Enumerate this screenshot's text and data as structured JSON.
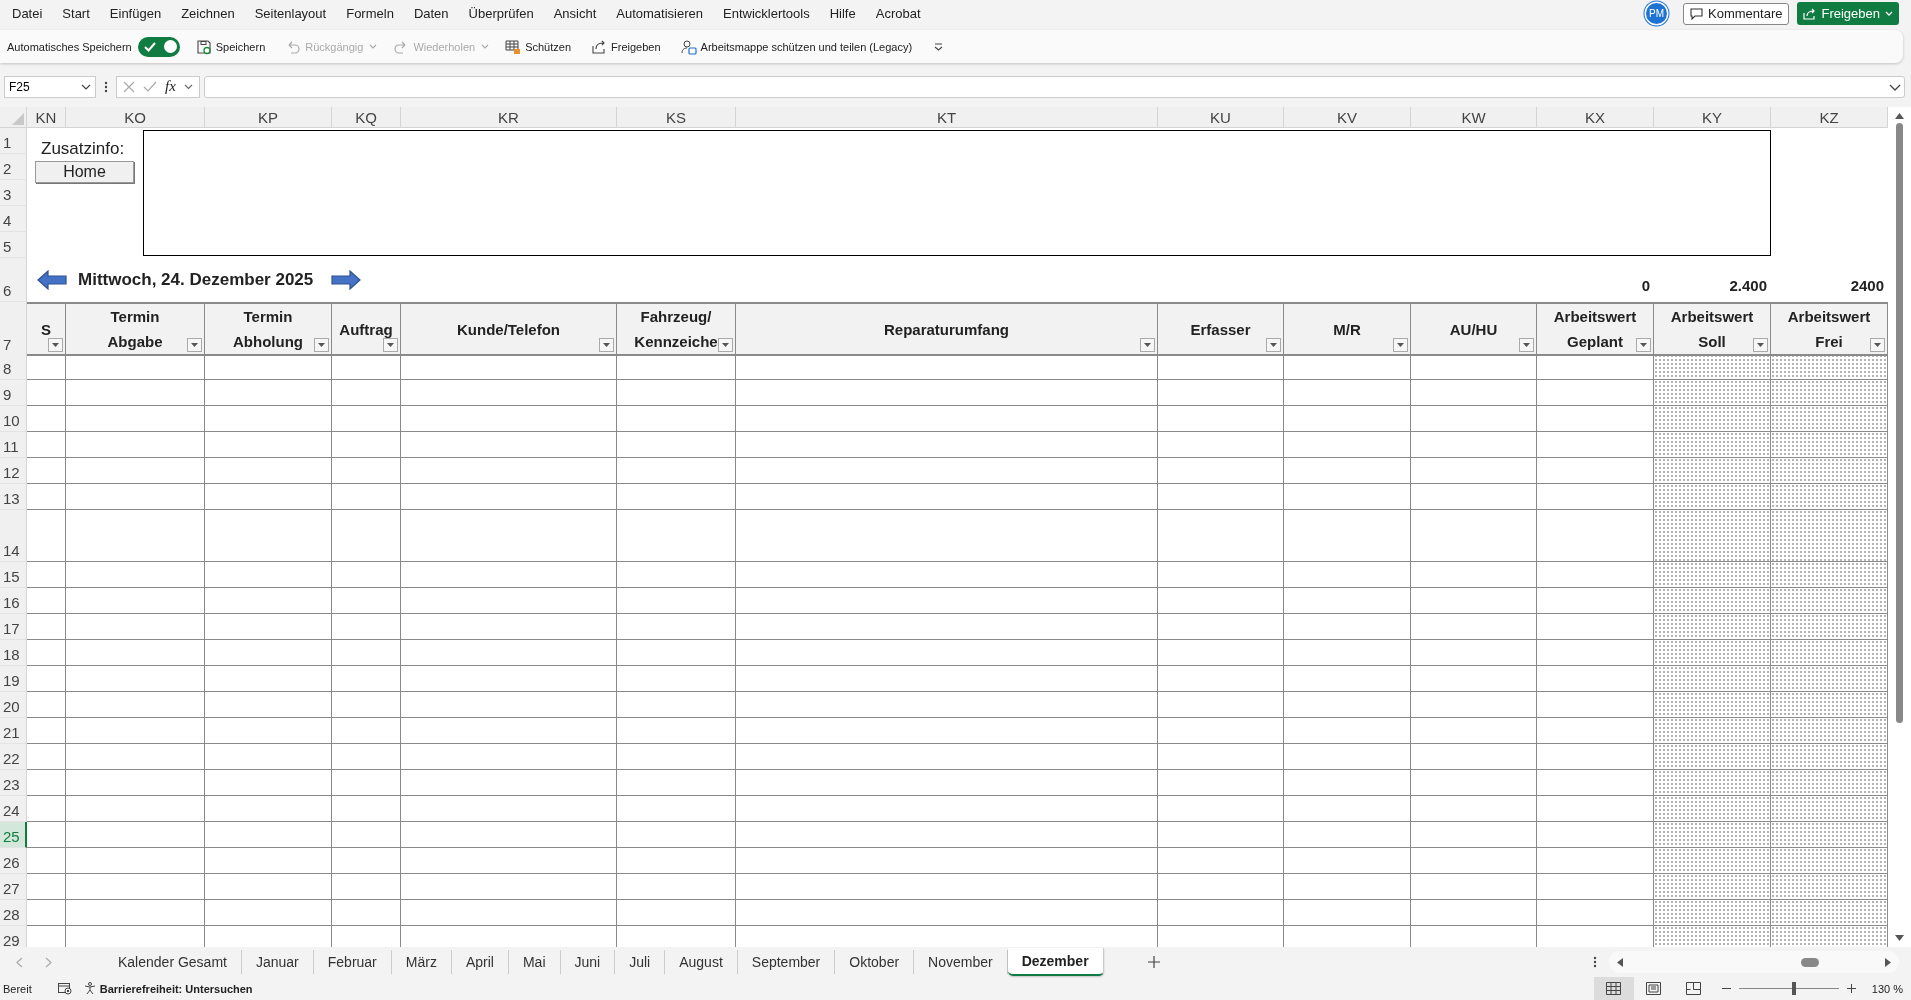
{
  "menu": [
    "Datei",
    "Start",
    "Einfügen",
    "Zeichnen",
    "Seitenlayout",
    "Formeln",
    "Daten",
    "Überprüfen",
    "Ansicht",
    "Automatisieren",
    "Entwicklertools",
    "Hilfe",
    "Acrobat"
  ],
  "account": {
    "initials": "PM"
  },
  "comments_button": "Kommentare",
  "share_button": "Freigeben",
  "toolbar": {
    "autosave_label": "Automatisches Speichern",
    "autosave_on": true,
    "items": [
      {
        "kind": "save",
        "label": "Speichern",
        "disabled": false,
        "dropdown": false
      },
      {
        "kind": "undo",
        "label": "Rückgängig",
        "disabled": true,
        "dropdown": true
      },
      {
        "kind": "redo",
        "label": "Wiederholen",
        "disabled": true,
        "dropdown": true
      },
      {
        "kind": "protect",
        "label": "Schützen",
        "disabled": false,
        "dropdown": false
      },
      {
        "kind": "share",
        "label": "Freigeben",
        "disabled": false,
        "dropdown": false
      },
      {
        "kind": "protect_share",
        "label": "Arbeitsmappe schützen und teilen (Legacy)",
        "disabled": false,
        "dropdown": false
      }
    ]
  },
  "formula_bar": {
    "name_box": "F25",
    "fx_label": "fx"
  },
  "columns": [
    {
      "letter": "KN",
      "header": "S",
      "shaded": false
    },
    {
      "letter": "KO",
      "header": "Termin\nAbgabe",
      "shaded": false
    },
    {
      "letter": "KP",
      "header": "Termin\nAbholung",
      "shaded": false
    },
    {
      "letter": "KQ",
      "header": "Auftrag",
      "shaded": false
    },
    {
      "letter": "KR",
      "header": "Kunde/Telefon",
      "shaded": false
    },
    {
      "letter": "KS",
      "header": "Fahrzeug/\nKennzeiche",
      "shaded": false
    },
    {
      "letter": "KT",
      "header": "Reparaturumfang",
      "shaded": false
    },
    {
      "letter": "KU",
      "header": "Erfasser",
      "shaded": false
    },
    {
      "letter": "KV",
      "header": "M/R",
      "shaded": false
    },
    {
      "letter": "KW",
      "header": "AU/HU",
      "shaded": false
    },
    {
      "letter": "KX",
      "header": "Arbeitswert\nGeplant",
      "shaded": false,
      "total": "0"
    },
    {
      "letter": "KY",
      "header": "Arbeitswert\nSoll",
      "shaded": true,
      "total": "2.400"
    },
    {
      "letter": "KZ",
      "header": "Arbeitswert\nFrei",
      "shaded": true,
      "total": "2400"
    }
  ],
  "rows": [
    {
      "number": "1",
      "selected": false
    },
    {
      "number": "2",
      "selected": false
    },
    {
      "number": "3",
      "selected": false
    },
    {
      "number": "4",
      "selected": false
    },
    {
      "number": "5",
      "selected": false
    },
    {
      "number": "6",
      "selected": false
    },
    {
      "number": "7",
      "selected": false
    },
    {
      "number": "8",
      "selected": false
    },
    {
      "number": "9",
      "selected": false
    },
    {
      "number": "10",
      "selected": false
    },
    {
      "number": "11",
      "selected": false
    },
    {
      "number": "12",
      "selected": false
    },
    {
      "number": "13",
      "selected": false
    },
    {
      "number": "14",
      "selected": false
    },
    {
      "number": "15",
      "selected": false
    },
    {
      "number": "16",
      "selected": false
    },
    {
      "number": "17",
      "selected": false
    },
    {
      "number": "18",
      "selected": false
    },
    {
      "number": "19",
      "selected": false
    },
    {
      "number": "20",
      "selected": false
    },
    {
      "number": "21",
      "selected": false
    },
    {
      "number": "22",
      "selected": false
    },
    {
      "number": "23",
      "selected": false
    },
    {
      "number": "24",
      "selected": false
    },
    {
      "number": "25",
      "selected": true
    },
    {
      "number": "26",
      "selected": false
    },
    {
      "number": "27",
      "selected": false
    },
    {
      "number": "28",
      "selected": false
    },
    {
      "number": "29",
      "selected": false
    }
  ],
  "sheet": {
    "info_label": "Zusatzinfo:",
    "home_button": "Home",
    "date": "Mittwoch, 24. Dezember 2025"
  },
  "sheet_tabs": [
    {
      "label": "Kalender Gesamt",
      "selected": false
    },
    {
      "label": "Januar",
      "selected": false
    },
    {
      "label": "Februar",
      "selected": false
    },
    {
      "label": "März",
      "selected": false
    },
    {
      "label": "April",
      "selected": false
    },
    {
      "label": "Mai",
      "selected": false
    },
    {
      "label": "Juni",
      "selected": false
    },
    {
      "label": "Juli",
      "selected": false
    },
    {
      "label": "August",
      "selected": false
    },
    {
      "label": "September",
      "selected": false
    },
    {
      "label": "Oktober",
      "selected": false
    },
    {
      "label": "November",
      "selected": false
    },
    {
      "label": "Dezember",
      "selected": true
    }
  ],
  "status": {
    "ready": "Bereit",
    "accessibility": "Barrierefreiheit: Untersuchen",
    "zoom": "130 %",
    "zoom_slider": {
      "level": 0.55
    },
    "views": [
      {
        "kind": "normal",
        "selected": true
      },
      {
        "kind": "page_layout",
        "selected": false
      },
      {
        "kind": "page_break",
        "selected": false
      }
    ]
  }
}
